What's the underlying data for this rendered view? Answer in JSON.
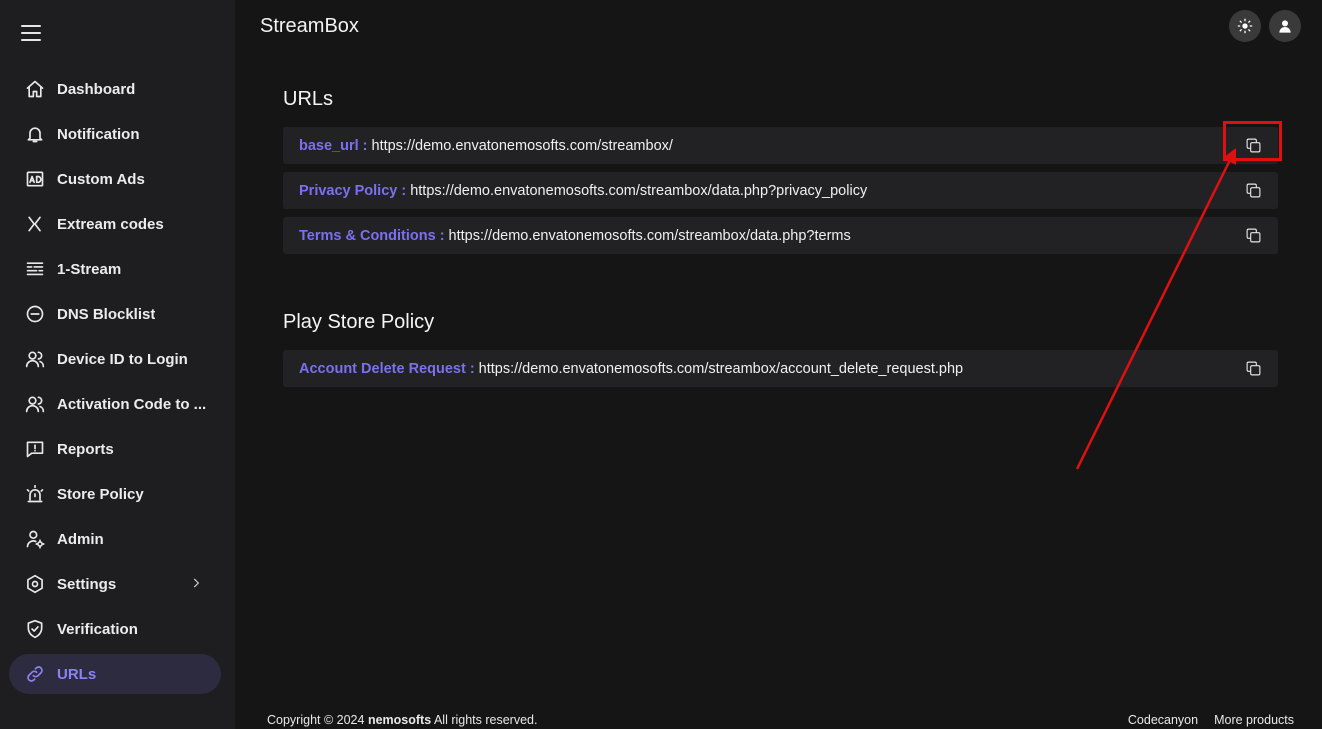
{
  "app": {
    "title": "StreamBox"
  },
  "sidebar": {
    "items": [
      {
        "label": "Dashboard",
        "icon": "home-icon"
      },
      {
        "label": "Notification",
        "icon": "bell-icon"
      },
      {
        "label": "Custom Ads",
        "icon": "ad-icon"
      },
      {
        "label": "Extream codes",
        "icon": "xtream-icon"
      },
      {
        "label": "1-Stream",
        "icon": "stream-icon"
      },
      {
        "label": "DNS Blocklist",
        "icon": "block-icon"
      },
      {
        "label": "Device ID to Login",
        "icon": "users-icon"
      },
      {
        "label": "Activation Code to ...",
        "icon": "users-icon"
      },
      {
        "label": "Reports",
        "icon": "report-icon"
      },
      {
        "label": "Store Policy",
        "icon": "siren-icon"
      },
      {
        "label": "Admin",
        "icon": "admin-icon"
      },
      {
        "label": "Settings",
        "icon": "settings-icon"
      },
      {
        "label": "Verification",
        "icon": "shield-check-icon"
      },
      {
        "label": "URLs",
        "icon": "link-icon"
      }
    ],
    "active": "URLs",
    "accent_color": "#8b83f5"
  },
  "urls_section": {
    "title": "URLs",
    "rows": [
      {
        "key": "base_url :",
        "value": "https://demo.envatonemosofts.com/streambox/"
      },
      {
        "key": "Privacy Policy :",
        "value": "https://demo.envatonemosofts.com/streambox/data.php?privacy_policy"
      },
      {
        "key": "Terms & Conditions :",
        "value": "https://demo.envatonemosofts.com/streambox/data.php?terms"
      }
    ]
  },
  "play_store_section": {
    "title": "Play Store Policy",
    "rows": [
      {
        "key": "Account Delete Request :",
        "value": "https://demo.envatonemosofts.com/streambox/account_delete_request.php"
      }
    ]
  },
  "footer": {
    "copyright_prefix": "Copyright © 2024",
    "company": "nemosofts",
    "copyright_suffix": "All rights reserved.",
    "links": [
      "Codecanyon",
      "More products"
    ]
  },
  "colors": {
    "key_color": "#7a70f0",
    "annotation_color": "#e01010"
  }
}
